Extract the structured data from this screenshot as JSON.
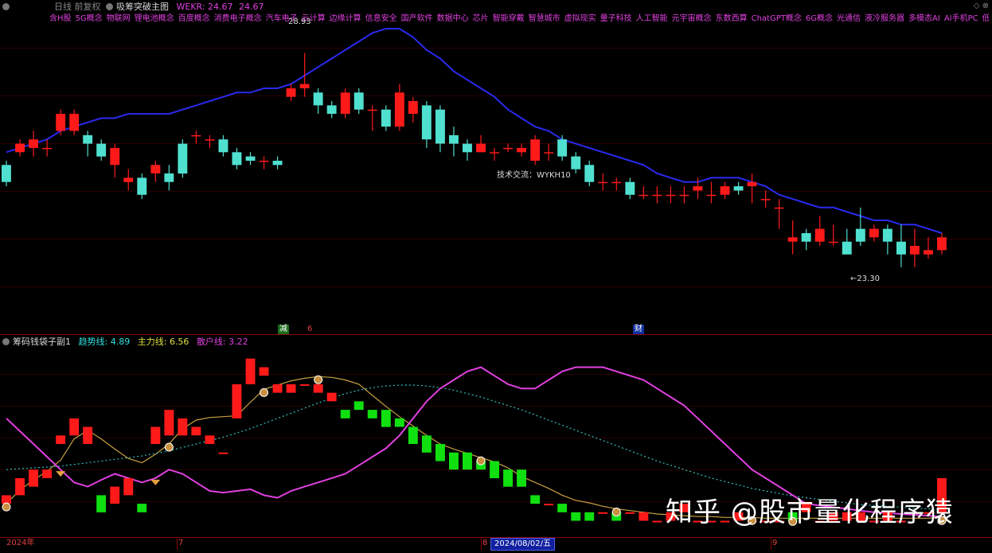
{
  "main_header": {
    "period": "日线 前复权",
    "indicator_name": "吸筹突破主图",
    "wekr_label": "WEKR: 24.67",
    "wekr_value": "24.67"
  },
  "concepts": [
    "含H股",
    "5G概念",
    "物联网",
    "锂电池概念",
    "百度概念",
    "消费电子概念",
    "汽车电子",
    "云计算",
    "边缘计算",
    "信息安全",
    "国产软件",
    "数据中心",
    "芯片",
    "智能穿戴",
    "智慧城市",
    "虚拟现实",
    "量子科技",
    "人工智能",
    "元宇宙概念",
    "东数西算",
    "ChatGPT概念",
    "6G概念",
    "光通信",
    "液冷服务器",
    "多模态AI",
    "AI手机PC",
    "低空经济"
  ],
  "annotations": {
    "high_label": "28.93",
    "low_label": "←23.30",
    "tech_label": "技术交流：WYKH10"
  },
  "markers": {
    "reduce": "减",
    "six": "6",
    "cai": "财"
  },
  "sub_header": {
    "name": "筹码钱袋子副1",
    "trend_label": "趋势线:",
    "trend_value": "4.89",
    "main_label": "主力线:",
    "main_value": "6.56",
    "retail_label": "散户线:",
    "retail_value": "3.22"
  },
  "x_labels": {
    "start": "2024年",
    "jul": "7",
    "aug": "8",
    "cursor_date": "2024/08/02/五",
    "sep": "9"
  },
  "watermark": "知乎 @股市量化程序猿",
  "colors": {
    "up": "#ff1a1a",
    "down": "#4fe0d0",
    "ma": "#2a2af0",
    "retail": "#e040e0",
    "trend": "#30c0c0",
    "main_line": "#c8a040",
    "grid": "#8b0000"
  },
  "chart_data": [
    {
      "type": "candlestick",
      "title": "吸筹突破主图",
      "ylim": [
        22.7,
        29.8
      ],
      "x": [
        1,
        2,
        3,
        4,
        5,
        6,
        7,
        8,
        9,
        10,
        11,
        12,
        13,
        14,
        15,
        16,
        17,
        18,
        19,
        20,
        21,
        22,
        23,
        24,
        25,
        26,
        27,
        28,
        29,
        30,
        31,
        32,
        33,
        34,
        35,
        36,
        37,
        38,
        39,
        40,
        41,
        42,
        43,
        44,
        45,
        46,
        47,
        48,
        49,
        50,
        51,
        52,
        53,
        54,
        55,
        56,
        57,
        58,
        59,
        60,
        61,
        62,
        63,
        64,
        65,
        66,
        67,
        68,
        69,
        70
      ],
      "open": [
        26.3,
        26.6,
        26.7,
        26.7,
        27.1,
        27.1,
        27.0,
        26.8,
        26.3,
        25.9,
        26.0,
        26.1,
        26.1,
        26.8,
        27.0,
        26.9,
        26.9,
        26.6,
        26.5,
        26.4,
        26.4,
        27.9,
        28.1,
        28.0,
        27.7,
        27.5,
        28.0,
        27.6,
        27.6,
        27.2,
        27.5,
        27.7,
        27.6,
        27.0,
        26.8,
        26.6,
        26.6,
        26.7,
        26.6,
        26.4,
        26.6,
        26.9,
        26.5,
        26.3,
        25.9,
        25.9,
        25.9,
        25.6,
        25.6,
        25.6,
        25.6,
        25.7,
        25.6,
        25.6,
        25.8,
        25.8,
        25.5,
        25.3,
        24.5,
        24.7,
        24.5,
        24.5,
        24.5,
        24.8,
        24.6,
        24.8,
        24.5,
        24.2,
        24.2,
        24.3
      ],
      "close": [
        25.9,
        26.8,
        26.9,
        26.7,
        27.5,
        27.5,
        26.8,
        26.5,
        26.7,
        26.0,
        25.6,
        26.3,
        25.9,
        26.1,
        27.0,
        26.9,
        26.6,
        26.3,
        26.4,
        26.4,
        26.3,
        28.1,
        28.2,
        27.7,
        27.5,
        28.0,
        27.6,
        27.6,
        27.2,
        28.0,
        27.8,
        26.9,
        26.8,
        26.8,
        26.6,
        26.8,
        26.6,
        26.7,
        26.7,
        26.9,
        26.6,
        26.5,
        26.2,
        25.9,
        25.9,
        25.9,
        25.6,
        25.6,
        25.6,
        25.6,
        25.6,
        25.8,
        25.6,
        25.8,
        25.7,
        25.9,
        25.5,
        25.3,
        24.6,
        24.5,
        24.8,
        24.5,
        24.2,
        24.5,
        24.8,
        24.5,
        24.2,
        24.4,
        24.3,
        24.6
      ],
      "high": [
        26.4,
        26.9,
        27.1,
        26.9,
        27.6,
        27.6,
        27.1,
        26.9,
        26.8,
        26.2,
        26.1,
        26.4,
        26.3,
        26.9,
        27.1,
        27.0,
        27.0,
        26.7,
        26.6,
        26.5,
        26.5,
        28.2,
        28.93,
        28.1,
        27.8,
        28.1,
        28.1,
        27.7,
        27.7,
        28.2,
        27.9,
        27.8,
        27.7,
        27.2,
        26.9,
        27.0,
        26.7,
        26.8,
        26.8,
        27.0,
        26.8,
        27.0,
        26.6,
        26.4,
        26.1,
        26.0,
        26.0,
        25.8,
        25.8,
        25.8,
        25.8,
        26.0,
        25.9,
        25.9,
        25.9,
        26.1,
        25.7,
        25.5,
        25.0,
        24.8,
        25.1,
        24.9,
        24.8,
        25.3,
        24.9,
        24.9,
        24.9,
        24.8,
        24.6,
        24.7
      ],
      "low": [
        25.8,
        26.5,
        26.5,
        26.5,
        27.0,
        27.0,
        26.5,
        26.4,
        26.0,
        25.7,
        25.5,
        25.9,
        25.7,
        26.0,
        26.8,
        26.7,
        26.5,
        26.2,
        26.3,
        26.2,
        26.2,
        27.8,
        27.9,
        27.5,
        27.4,
        27.4,
        27.5,
        27.1,
        27.1,
        27.1,
        27.3,
        26.7,
        26.6,
        26.5,
        26.4,
        26.6,
        26.4,
        26.6,
        26.5,
        26.3,
        26.4,
        26.4,
        26.1,
        25.8,
        25.7,
        25.7,
        25.5,
        25.5,
        25.4,
        25.4,
        25.4,
        25.5,
        25.4,
        25.5,
        25.6,
        25.4,
        25.3,
        24.8,
        24.2,
        24.3,
        24.4,
        24.4,
        24.2,
        24.4,
        24.5,
        24.2,
        23.9,
        23.9,
        24.1,
        24.2
      ],
      "ma": [
        26.6,
        26.7,
        26.8,
        26.9,
        27.1,
        27.2,
        27.3,
        27.4,
        27.4,
        27.5,
        27.5,
        27.5,
        27.5,
        27.6,
        27.7,
        27.8,
        27.9,
        28.0,
        28.0,
        28.1,
        28.1,
        28.2,
        28.4,
        28.6,
        28.8,
        29.0,
        29.2,
        29.4,
        29.5,
        29.5,
        29.3,
        29.0,
        28.8,
        28.5,
        28.3,
        28.1,
        27.9,
        27.6,
        27.4,
        27.2,
        27.1,
        26.9,
        26.8,
        26.7,
        26.6,
        26.5,
        26.4,
        26.3,
        26.1,
        26.0,
        25.9,
        25.9,
        26.0,
        26.0,
        26.0,
        25.9,
        25.8,
        25.6,
        25.5,
        25.4,
        25.3,
        25.3,
        25.2,
        25.1,
        25.0,
        25.0,
        24.9,
        24.9,
        24.8,
        24.7
      ]
    },
    {
      "type": "bar",
      "title": "筹码钱袋子副1",
      "ylim": [
        -2,
        20
      ],
      "x": [
        1,
        2,
        3,
        4,
        5,
        6,
        7,
        8,
        9,
        10,
        11,
        12,
        13,
        14,
        15,
        16,
        17,
        18,
        19,
        20,
        21,
        22,
        23,
        24,
        25,
        26,
        27,
        28,
        29,
        30,
        31,
        32,
        33,
        34,
        35,
        36,
        37,
        38,
        39,
        40,
        41,
        42,
        43,
        44,
        45,
        46,
        47,
        48,
        49,
        50,
        51,
        52,
        53,
        54,
        55,
        56,
        57,
        58,
        59,
        60,
        61,
        62,
        63,
        64,
        65,
        66,
        67,
        68,
        69,
        70
      ],
      "bar_base": [
        2,
        3,
        4,
        5,
        9,
        10,
        9,
        3,
        2,
        3,
        2,
        9,
        10,
        10,
        10,
        9,
        8,
        12,
        16,
        17,
        15,
        15,
        16,
        15,
        14,
        13,
        14,
        13,
        13,
        12,
        11,
        10,
        9,
        8,
        8,
        7,
        7,
        6,
        6,
        3,
        2,
        2,
        1,
        1,
        1,
        1,
        1,
        0,
        0,
        0,
        1,
        0,
        0,
        0,
        0,
        0,
        0,
        0,
        1,
        1,
        0,
        0,
        0,
        0,
        0,
        0,
        0,
        1,
        1,
        1
      ],
      "bar_top": [
        3,
        5,
        6,
        6,
        10,
        12,
        11,
        1,
        4,
        5,
        1,
        11,
        13,
        12,
        11,
        10,
        8,
        16,
        19,
        18,
        16,
        16,
        16,
        16,
        15,
        12,
        13,
        12,
        11,
        11,
        9,
        8,
        7,
        6,
        6,
        6,
        5,
        4,
        4,
        2,
        2,
        1,
        0,
        0,
        1,
        0,
        1,
        1,
        0,
        1,
        2,
        0,
        0,
        0,
        1,
        0,
        0,
        0,
        0,
        2,
        0,
        1,
        1,
        1,
        0,
        1,
        0,
        1,
        1,
        5
      ],
      "series": [
        {
          "name": "主力线",
          "values": [
            2.0,
            3.6,
            4.8,
            5.8,
            7.1,
            9.6,
            10.6,
            9.6,
            8.4,
            7.3,
            6.8,
            7.8,
            9.0,
            10.8,
            11.8,
            12.1,
            12.2,
            12.3,
            13.9,
            15.4,
            15.9,
            16.4,
            16.7,
            16.9,
            16.8,
            16.5,
            16.0,
            14.7,
            13.4,
            12.2,
            11.1,
            10.0,
            9.0,
            8.4,
            7.9,
            7.4,
            6.9,
            6.2,
            5.2,
            4.5,
            3.8,
            3.0,
            2.4,
            2.1,
            1.7,
            1.4,
            1.2,
            1.0,
            0.8,
            0.7,
            0.6,
            0.5,
            0.5,
            0.4,
            0.4,
            0.4,
            0.3,
            0.3,
            0.3,
            0.3,
            0.3,
            0.3,
            0.3,
            0.3,
            0.3,
            0.3,
            0.3,
            0.3,
            0.3,
            0.4
          ]
        },
        {
          "name": "趋势线",
          "values": [
            6.0,
            6.1,
            6.2,
            6.3,
            6.4,
            6.6,
            6.8,
            7.0,
            7.2,
            7.4,
            7.6,
            7.9,
            8.2,
            8.6,
            9.0,
            9.4,
            9.8,
            10.3,
            10.8,
            11.4,
            12.0,
            12.6,
            13.2,
            13.8,
            14.4,
            14.9,
            15.3,
            15.6,
            15.8,
            15.9,
            15.9,
            15.8,
            15.6,
            15.3,
            14.9,
            14.5,
            14.0,
            13.5,
            13.0,
            12.4,
            11.8,
            11.2,
            10.6,
            10.0,
            9.4,
            8.8,
            8.2,
            7.6,
            7.0,
            6.5,
            6.0,
            5.5,
            5.0,
            4.6,
            4.2,
            3.8,
            3.5,
            3.2,
            2.9,
            2.7,
            2.5,
            2.3,
            2.1,
            1.9,
            1.8,
            1.7,
            1.6,
            1.5,
            1.4,
            1.3
          ]
        },
        {
          "name": "散户线",
          "values": [
            12.0,
            10.5,
            9.0,
            7.5,
            6.0,
            4.5,
            4.0,
            4.8,
            5.5,
            5.0,
            4.5,
            5.0,
            6.0,
            5.5,
            4.5,
            3.5,
            3.3,
            3.5,
            3.7,
            3.0,
            2.7,
            3.5,
            4.0,
            4.5,
            5.0,
            5.5,
            6.5,
            7.5,
            8.5,
            10.0,
            12.0,
            14.0,
            15.5,
            16.5,
            17.5,
            18.0,
            17.0,
            16.0,
            15.5,
            15.5,
            16.5,
            17.5,
            18.0,
            18.0,
            18.0,
            17.5,
            17.0,
            16.5,
            15.5,
            14.5,
            13.5,
            12.0,
            10.5,
            9.0,
            7.5,
            6.0,
            5.0,
            4.0,
            3.0,
            2.0,
            1.8,
            1.6,
            1.4,
            1.2,
            1.0,
            0.9,
            0.8,
            0.7,
            0.6,
            0.5
          ]
        }
      ]
    }
  ]
}
